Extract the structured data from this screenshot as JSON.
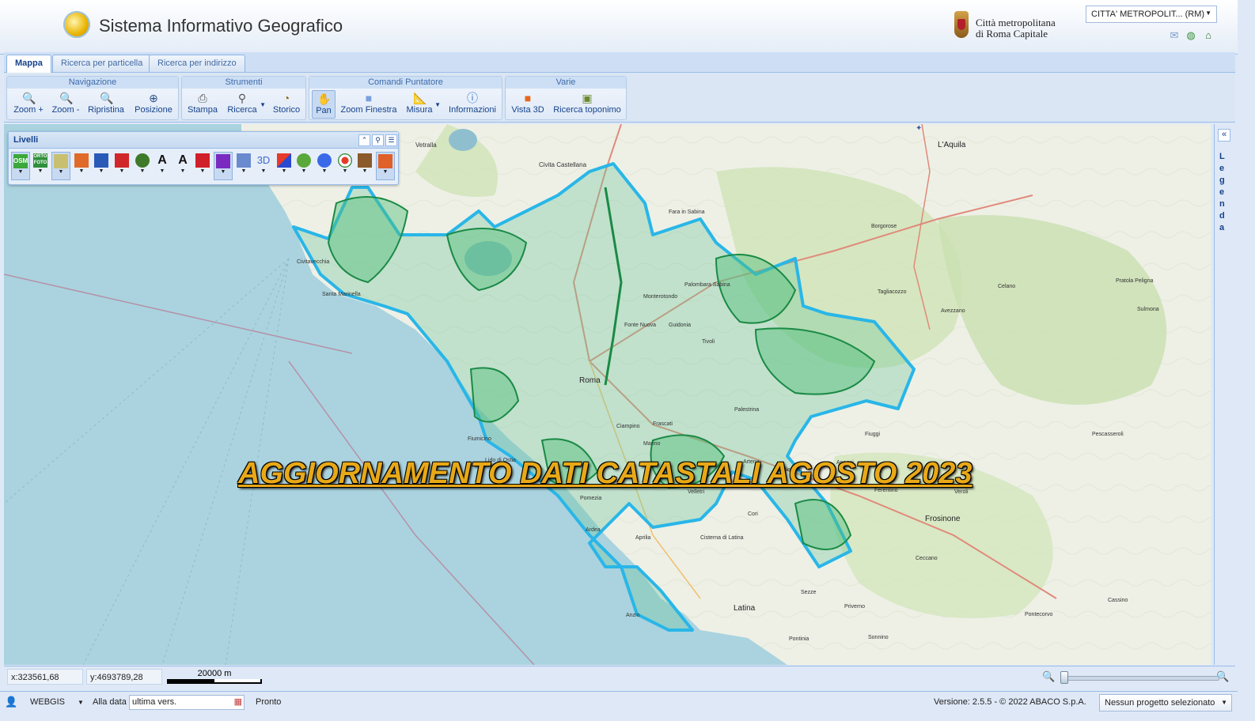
{
  "header": {
    "app_title": "Sistema Informativo Geografico",
    "org_line1": "Città metropolitana",
    "org_line2": "di Roma Capitale",
    "org_select": "CITTA' METROPOLIT... (RM)",
    "icons": [
      "mail-icon",
      "globe-icon",
      "home-icon"
    ]
  },
  "tabs": [
    {
      "label": "Mappa",
      "active": true
    },
    {
      "label": "Ricerca per particella",
      "active": false
    },
    {
      "label": "Ricerca per indirizzo",
      "active": false
    }
  ],
  "toolbar": {
    "groups": [
      {
        "title": "Navigazione",
        "buttons": [
          "Zoom +",
          "Zoom -",
          "Ripristina",
          "Posizione"
        ]
      },
      {
        "title": "Strumenti",
        "buttons": [
          "Stampa",
          "Ricerca",
          "Storico"
        ]
      },
      {
        "title": "Comandi Puntatore",
        "buttons": [
          "Pan",
          "Zoom Finestra",
          "Misura",
          "Informazioni"
        ]
      },
      {
        "title": "Varie",
        "buttons": [
          "Vista 3D",
          "Ricerca toponimo"
        ]
      }
    ]
  },
  "layers": {
    "title": "Livelli",
    "items": [
      "OSM",
      "ORTO FOTO",
      "",
      "",
      "",
      "",
      "",
      "A",
      "A",
      "",
      "",
      "",
      "3D",
      "",
      "",
      "",
      "",
      "",
      ""
    ]
  },
  "legend": {
    "label": "Legenda"
  },
  "banner": {
    "text": "AGGIORNAMENTO DATI CATASTALI AGOSTO 2023"
  },
  "map_labels": [
    "Vetralla",
    "Civita Castellana",
    "L'Aquila",
    "Civitavecchia",
    "Santa Marinella",
    "Borgorose",
    "Tagliacozzo",
    "Celano",
    "Pratola Peligna",
    "Sulmona",
    "Avezzano",
    "Roma",
    "Fiumicino",
    "Lido di Ostia",
    "Pomezia",
    "Ardea",
    "Aprilia",
    "Latina",
    "Anzio",
    "Cisterna di Latina",
    "Velletri",
    "Frosinone",
    "Fiuggi",
    "Anagni",
    "Sezze",
    "Priverno",
    "Pontecorvo",
    "Cassino",
    "Sonnino",
    "Pontinia",
    "Ferentino",
    "Veroli",
    "Ceccano",
    "Pescasseroli",
    "Palestrina",
    "Tivoli",
    "Guidonia",
    "Monterotondo",
    "Fonte Nuova",
    "Colleferro",
    "Artena",
    "Cori",
    "Marino",
    "Ciampino",
    "Frascati",
    "Fara in Sabina",
    "Palombara Sabina"
  ],
  "status": {
    "x": "x:323561,68",
    "y": "y:4693789,28",
    "scale": "20000 m"
  },
  "bottom": {
    "mode": "WEBGIS",
    "date_label": "Alla data",
    "date_value": "ultima vers.",
    "state": "Pronto",
    "version": "Versione: 2.5.5 - © 2022 ABACO S.p.A.",
    "project": "Nessun progetto selezionato"
  },
  "colors": {
    "boundary": "#29b6e8",
    "park_fill": "#4fbf7a",
    "park_border": "#1a8a45",
    "sea": "#aad3df",
    "land": "#eef0e6",
    "banner": "#e8a817"
  }
}
